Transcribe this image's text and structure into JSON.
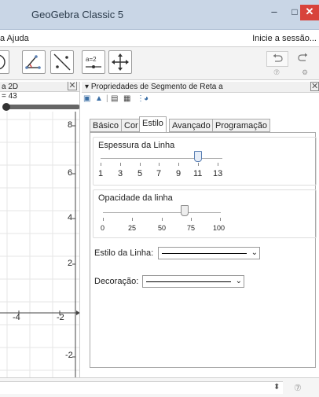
{
  "window": {
    "title": "GeoGebra Classic 5",
    "minimize_glyph": "–",
    "maximize_glyph": "□",
    "close_glyph": "✕"
  },
  "menubar": {
    "items": [
      "a Ajuda"
    ],
    "signin": "Inicie a sessão..."
  },
  "toolbar": {
    "slider_tool_label": "a=2",
    "undo_icon": "undo-icon",
    "redo_icon": "redo-icon",
    "help_icon": "help-icon",
    "settings_icon": "settings-icon"
  },
  "graphics_view": {
    "header": "a 2D",
    "slider_label": "= 43",
    "y_ticks": [
      "8",
      "6",
      "4",
      "2",
      "-2"
    ],
    "x_ticks": [
      "-4",
      "-2"
    ]
  },
  "properties": {
    "header": "Propriedades de Segmento de Reta a",
    "tabs": [
      "Básico",
      "Cor",
      "Estilo",
      "Avançado",
      "Programação"
    ],
    "active_tab": "Estilo",
    "line_thickness": {
      "title": "Espessura da Linha",
      "labels": [
        "1",
        "3",
        "5",
        "7",
        "9",
        "11",
        "13"
      ],
      "value": 11
    },
    "line_opacity": {
      "title": "Opacidade da linha",
      "labels": [
        "0",
        "25",
        "50",
        "75",
        "100"
      ],
      "value": 70
    },
    "line_style_label": "Estilo da Linha:",
    "decoration_label": "Decoração:"
  },
  "statusbar": {
    "input_value": "",
    "arrow_glyph": "◆",
    "help_glyph": "?"
  }
}
